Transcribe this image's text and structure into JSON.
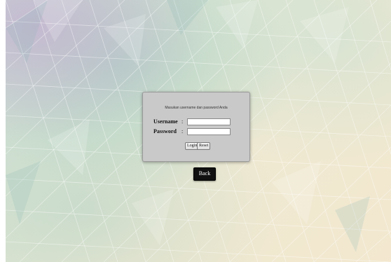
{
  "login": {
    "message": "Masukan username dan password Anda",
    "username_label": "Username",
    "password_label": "Password",
    "separator": ":",
    "username_value": "",
    "password_value": "",
    "login_label": "Login",
    "reset_label": "Reset"
  },
  "back_label": "Back",
  "colors": {
    "panel_bg": "#c9c9c9",
    "back_button_bg": "#111111"
  }
}
